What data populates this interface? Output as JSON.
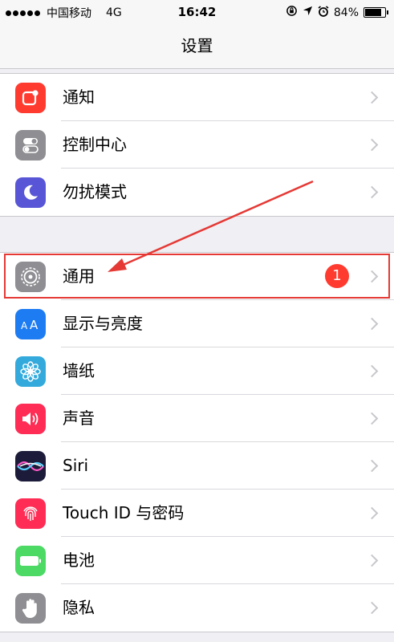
{
  "status_bar": {
    "carrier": "中国移动",
    "network": "4G",
    "time": "16:42",
    "battery": "84%",
    "battery_level": 0.84,
    "icons": [
      "orientation-lock-icon",
      "location-icon",
      "alarm-icon",
      "battery-icon"
    ]
  },
  "nav": {
    "title": "设置"
  },
  "groups": [
    {
      "items": [
        {
          "label": "通知",
          "icon": "notifications-icon",
          "color": "#ff3b30"
        },
        {
          "label": "控制中心",
          "icon": "control-center-icon",
          "color": "#8e8e93"
        },
        {
          "label": "勿扰模式",
          "icon": "moon-icon",
          "color": "#5856d6"
        }
      ]
    },
    {
      "items": [
        {
          "label": "通用",
          "icon": "gear-icon",
          "color": "#8e8e93",
          "badge": "1"
        },
        {
          "label": "显示与亮度",
          "icon": "display-brightness-icon",
          "color": "#1e7cf2"
        },
        {
          "label": "墙纸",
          "icon": "wallpaper-flower-icon",
          "color": "#34aadc"
        },
        {
          "label": "声音",
          "icon": "speaker-icon",
          "color": "#ff2d55"
        },
        {
          "label": "Siri",
          "icon": "siri-icon",
          "color": "#1c1c3a"
        },
        {
          "label": "Touch ID 与密码",
          "icon": "fingerprint-icon",
          "color": "#ff2d55"
        },
        {
          "label": "电池",
          "icon": "battery-icon",
          "color": "#4cd964"
        },
        {
          "label": "隐私",
          "icon": "hand-icon",
          "color": "#8e8e93"
        }
      ]
    }
  ],
  "annotation": {
    "color": "#e53935"
  }
}
